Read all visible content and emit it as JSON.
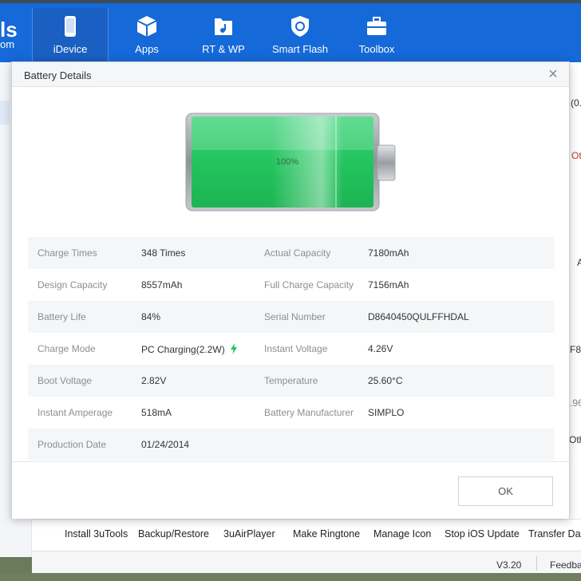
{
  "app": {
    "brand_line1": "ls",
    "brand_line2": "om",
    "nav": [
      {
        "label": "iDevice",
        "icon": "phone-icon"
      },
      {
        "label": "Apps",
        "icon": "cube-icon"
      },
      {
        "label": "RT & WP",
        "icon": "music-folder-icon"
      },
      {
        "label": "Smart Flash",
        "icon": "shield-refresh-icon"
      },
      {
        "label": "Toolbox",
        "icon": "toolbox-icon"
      }
    ],
    "peek": [
      "(0.",
      "Ot",
      "A",
      "F8",
      ".96",
      "Oth"
    ],
    "bottom_links": [
      "Install 3uTools",
      "Backup/Restore",
      "3uAirPlayer",
      "Make Ringtone",
      "Manage Icon",
      "Stop iOS Update",
      "Transfer Data"
    ],
    "version": "V3.20",
    "feedback": "Feedback"
  },
  "dialog": {
    "title": "Battery Details",
    "close_glyph": "×",
    "battery_level": 100,
    "battery_percent_label": "100%",
    "ok_label": "OK",
    "colors": {
      "battery_fill": "#22c45e",
      "accent": "#1569d8",
      "bolt": "#22c45e"
    },
    "rows": [
      [
        {
          "label": "Charge Times",
          "value": "348 Times"
        },
        {
          "label": "Actual Capacity",
          "value": "7180mAh"
        }
      ],
      [
        {
          "label": "Design Capacity",
          "value": "8557mAh"
        },
        {
          "label": "Full Charge Capacity",
          "value": "7156mAh"
        }
      ],
      [
        {
          "label": "Battery Life",
          "value": "84%"
        },
        {
          "label": "Serial Number",
          "value": "D8640450QULFFHDAL"
        }
      ],
      [
        {
          "label": "Charge Mode",
          "value": "PC Charging(2.2W)"
        },
        {
          "label": "Instant Voltage",
          "value": "4.26V"
        }
      ],
      [
        {
          "label": "Boot Voltage",
          "value": "2.82V"
        },
        {
          "label": "Temperature",
          "value": "25.60°C"
        }
      ],
      [
        {
          "label": "Instant Amperage",
          "value": "518mA"
        },
        {
          "label": "Battery Manufacturer",
          "value": "SIMPLO"
        }
      ],
      [
        {
          "label": "Production Date",
          "value": "01/24/2014"
        }
      ]
    ]
  }
}
